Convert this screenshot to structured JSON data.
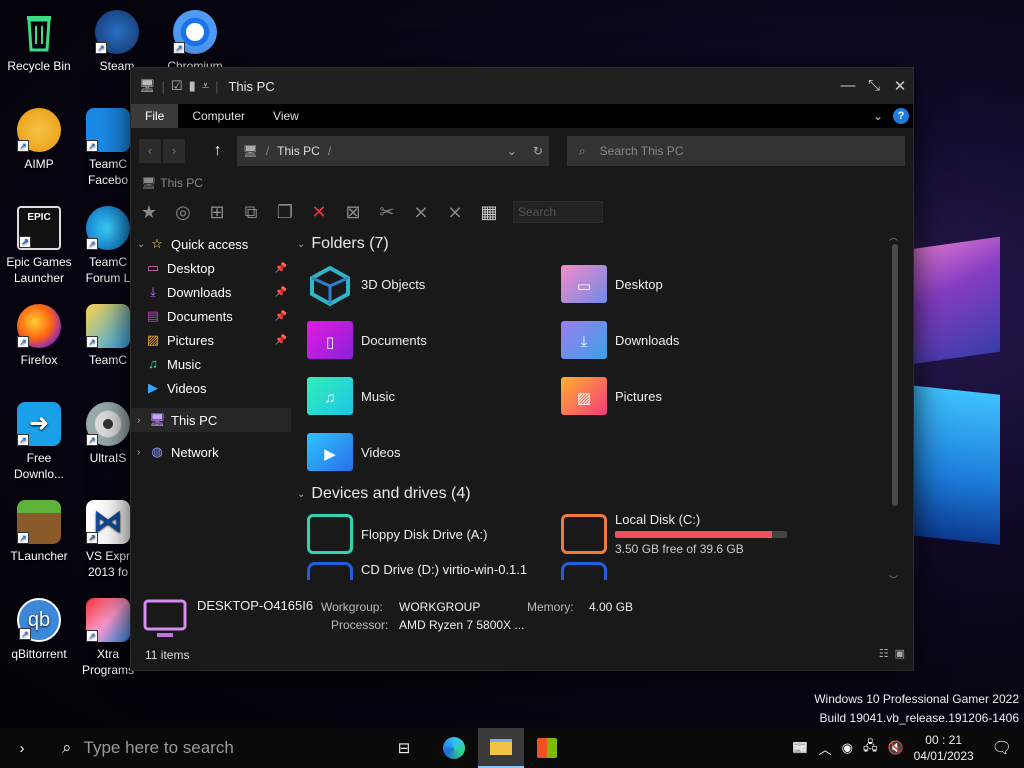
{
  "desktop": {
    "icons": [
      {
        "label": "Recycle Bin",
        "icon": "recycle-bin-icon"
      },
      {
        "label": "Steam",
        "icon": "steam-icon"
      },
      {
        "label": "Chromium",
        "icon": "chromium-icon"
      },
      {
        "label": "AIMP",
        "icon": "aimp-icon"
      },
      {
        "label": "TeamC Facebo",
        "icon": "teamc-facebook-icon"
      },
      {
        "label": "Epic Games Launcher",
        "icon": "epic-games-icon"
      },
      {
        "label": "TeamC Forum L",
        "icon": "teamc-forum-icon"
      },
      {
        "label": "Firefox",
        "icon": "firefox-icon"
      },
      {
        "label": "TeamC",
        "icon": "teamc-icon"
      },
      {
        "label": "Free Downlo...",
        "icon": "free-download-icon"
      },
      {
        "label": "UltraIS",
        "icon": "ultraiso-icon"
      },
      {
        "label": "TLauncher",
        "icon": "tlauncher-icon"
      },
      {
        "label": "VS Expr 2013 fo",
        "icon": "vs-express-icon"
      },
      {
        "label": "qBittorrent",
        "icon": "qbittorrent-icon"
      },
      {
        "label": "Xtra Programs",
        "icon": "xtra-programs-icon"
      }
    ]
  },
  "window": {
    "title": "This PC",
    "ribbon_tabs": [
      "File",
      "Computer",
      "View"
    ],
    "address": "This PC",
    "search_placeholder": "Search This PC",
    "breadcrumb": "This PC",
    "toolbar_search": "Search",
    "nav": {
      "quick_access": "Quick access",
      "items": [
        {
          "label": "Desktop",
          "pinned": true,
          "icon": "desktop-icon",
          "color": "#e86fc3"
        },
        {
          "label": "Downloads",
          "pinned": true,
          "icon": "downloads-icon",
          "color": "#b07cff"
        },
        {
          "label": "Documents",
          "pinned": true,
          "icon": "documents-icon",
          "color": "#d234d0"
        },
        {
          "label": "Pictures",
          "pinned": true,
          "icon": "pictures-icon",
          "color": "#f5a623"
        },
        {
          "label": "Music",
          "pinned": false,
          "icon": "music-icon",
          "color": "#2de1b0"
        },
        {
          "label": "Videos",
          "pinned": false,
          "icon": "videos-icon",
          "color": "#37a8ff"
        }
      ],
      "this_pc": "This PC",
      "network": "Network"
    },
    "folders_header": "Folders (7)",
    "folders": [
      {
        "label": "3D Objects",
        "icon": "3d-objects-icon",
        "color": "#2fb6c6"
      },
      {
        "label": "Desktop",
        "icon": "desktop-folder-icon",
        "color": "#d872c9"
      },
      {
        "label": "Documents",
        "icon": "documents-folder-icon",
        "color": "#c41fd8"
      },
      {
        "label": "Downloads",
        "icon": "downloads-folder-icon",
        "color": "#6b88e8"
      },
      {
        "label": "Music",
        "icon": "music-folder-icon",
        "color": "#1fe3b6"
      },
      {
        "label": "Pictures",
        "icon": "pictures-folder-icon",
        "color": "#f7664e"
      },
      {
        "label": "Videos",
        "icon": "videos-folder-icon",
        "color": "#2f8ff0"
      }
    ],
    "drives_header": "Devices and drives (4)",
    "drives": [
      {
        "label": "Floppy Disk Drive (A:)",
        "icon": "floppy-drive-icon",
        "color": "#2fd4b0"
      },
      {
        "label": "Local Disk (C:)",
        "icon": "local-disk-icon",
        "color": "#f07a3a",
        "free": "3.50 GB free of 39.6 GB",
        "used_fraction": 0.91
      },
      {
        "label": "CD Drive (D:) virtio-win-0.1.1",
        "icon": "cd-drive-icon",
        "color": "#2060e0"
      }
    ],
    "details": {
      "computer_name": "DESKTOP-O4165I6",
      "workgroup_label": "Workgroup:",
      "workgroup": "WORKGROUP",
      "memory_label": "Memory:",
      "memory": "4.00 GB",
      "processor_label": "Processor:",
      "processor": "AMD Ryzen 7 5800X ...",
      "items_count": "11 items"
    }
  },
  "watermark": {
    "line1": "Windows 10 Professional Gamer 2022",
    "line2": "Build 19041.vb_release.191206-1406"
  },
  "taskbar": {
    "search_placeholder": "Type here to search",
    "time": "00 : 21",
    "date": "04/01/2023"
  }
}
